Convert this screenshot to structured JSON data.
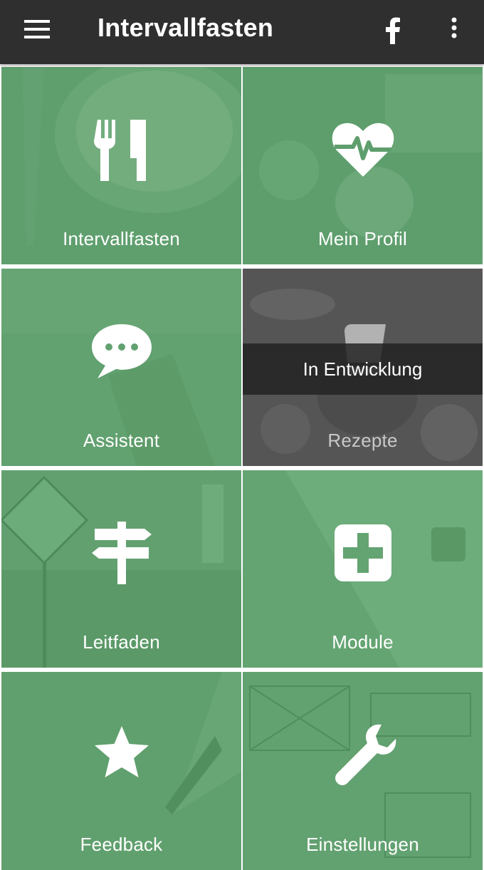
{
  "app": {
    "title": "Intervallfasten",
    "toolbar_icons": [
      "menu-icon",
      "facebook-icon",
      "more-vertical-icon"
    ]
  },
  "tiles": [
    {
      "label": "Intervallfasten",
      "icon": "fork-knife-icon"
    },
    {
      "label": "Mein Profil",
      "icon": "heart-pulse-icon"
    },
    {
      "label": "Assistent",
      "icon": "chat-bubble-icon"
    },
    {
      "label": "Rezepte",
      "icon": "book-icon",
      "badge": "In Entwicklung",
      "disabled": true
    },
    {
      "label": "Leitfaden",
      "icon": "signpost-icon"
    },
    {
      "label": "Module",
      "icon": "plus-square-icon"
    },
    {
      "label": "Feedback",
      "icon": "star-icon"
    },
    {
      "label": "Einstellungen",
      "icon": "wrench-icon"
    }
  ],
  "colors": {
    "appbar": "#2f2f2f",
    "tile_green": "#5d9d6c",
    "tile_disabled": "#5a5a5a",
    "text": "#ffffff"
  }
}
